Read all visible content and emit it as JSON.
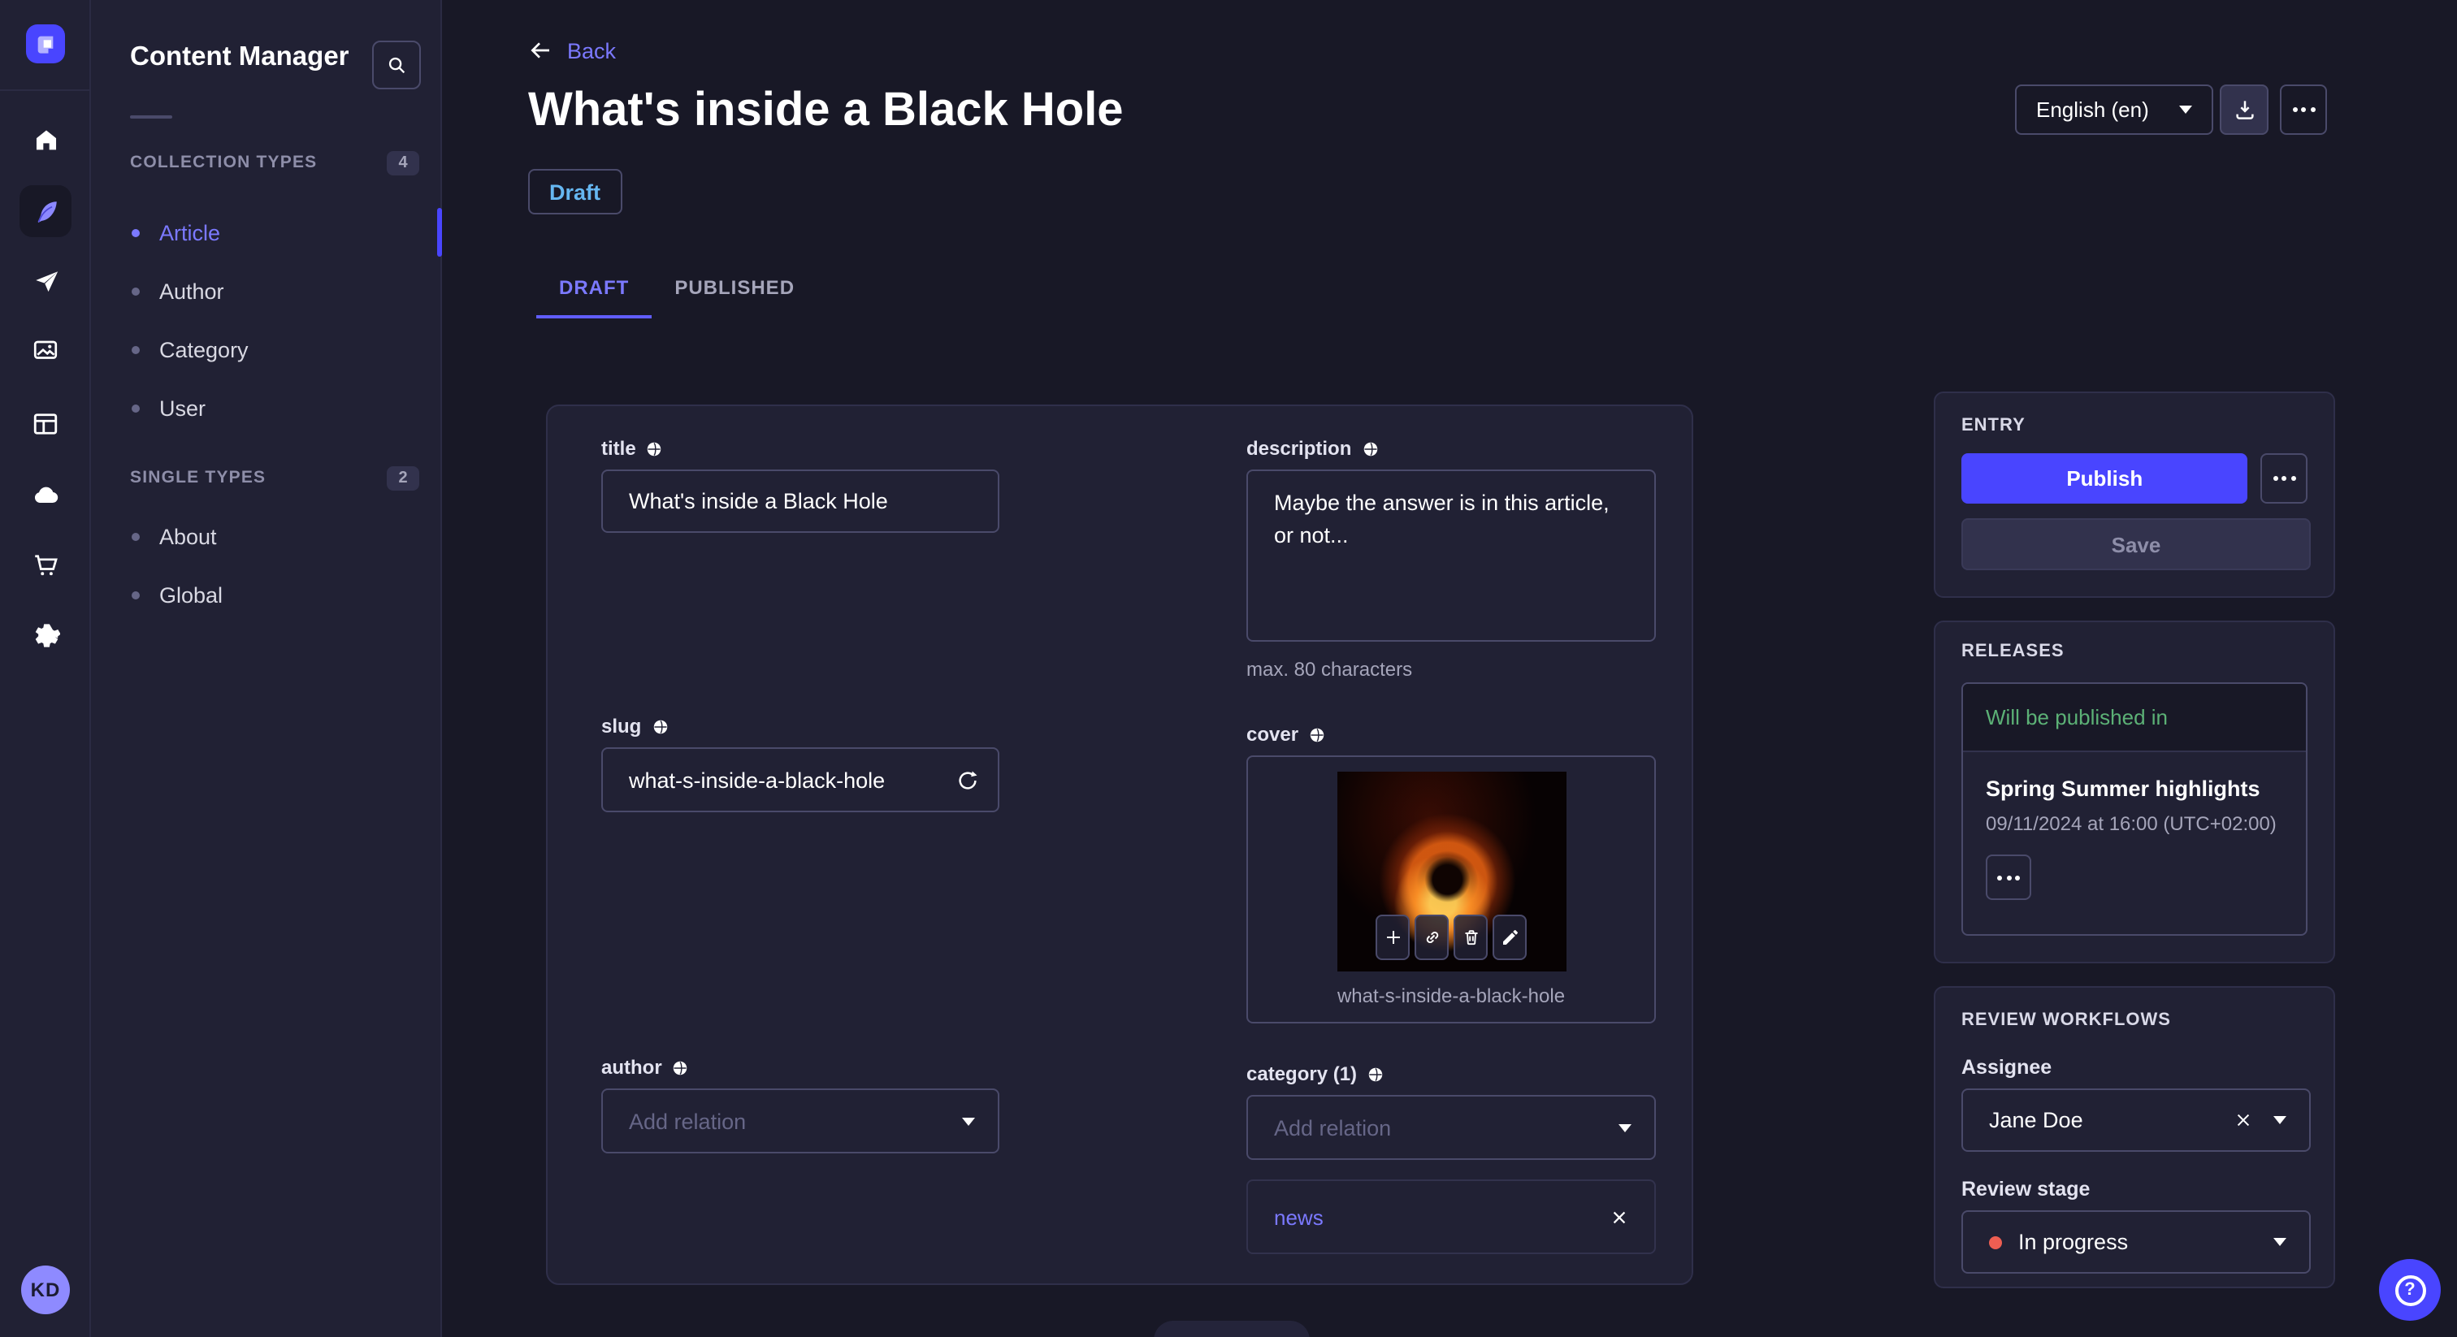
{
  "subnav": {
    "title": "Content Manager",
    "sections": [
      {
        "label": "COLLECTION TYPES",
        "badge": "4",
        "items": [
          {
            "label": "Article"
          },
          {
            "label": "Author"
          },
          {
            "label": "Category"
          },
          {
            "label": "User"
          }
        ]
      },
      {
        "label": "SINGLE TYPES",
        "badge": "2",
        "items": [
          {
            "label": "About"
          },
          {
            "label": "Global"
          }
        ]
      }
    ]
  },
  "header": {
    "back_label": "Back",
    "title": "What's inside a Black Hole",
    "status_badge": "Draft",
    "locale": "English (en)",
    "tabs": {
      "draft": "DRAFT",
      "published": "PUBLISHED"
    }
  },
  "form": {
    "title": {
      "label": "title",
      "value": "What's inside a Black Hole"
    },
    "description": {
      "label": "description",
      "value": "Maybe the answer is in this article, or not...",
      "hint": "max. 80 characters"
    },
    "slug": {
      "label": "slug",
      "value": "what-s-inside-a-black-hole"
    },
    "cover": {
      "label": "cover",
      "caption": "what-s-inside-a-black-hole"
    },
    "author": {
      "label": "author",
      "placeholder": "Add relation"
    },
    "category": {
      "label": "category (1)",
      "placeholder": "Add relation",
      "relation": "news"
    }
  },
  "entry": {
    "heading": "ENTRY",
    "publish_label": "Publish",
    "save_label": "Save"
  },
  "releases": {
    "heading": "RELEASES",
    "banner": "Will be published in",
    "name": "Spring Summer highlights",
    "date": "09/11/2024 at 16:00 (UTC+02:00)"
  },
  "review": {
    "heading": "REVIEW WORKFLOWS",
    "assignee_label": "Assignee",
    "assignee_value": "Jane Doe",
    "stage_label": "Review stage",
    "stage_value": "In progress"
  },
  "user": {
    "initials": "KD"
  },
  "help": {
    "glyph": "?"
  },
  "colors": {
    "primary": "#4945ff",
    "primary_light": "#7b79ff",
    "success": "#5cb176",
    "danger": "#ee5e52",
    "draft_badge": "#66b7f1"
  },
  "icons": {
    "rail": [
      "home-icon",
      "content-manager-icon",
      "releases-icon",
      "media-library-icon",
      "content-type-builder-icon",
      "cloud-icon",
      "marketplace-icon",
      "settings-icon"
    ],
    "search": "magnifier-icon",
    "download": "download-icon",
    "more": "ellipsis-icon",
    "back": "arrow-left-icon",
    "localized_field": "globe-icon",
    "regenerate": "refresh-icon",
    "cover_actions": [
      "plus-icon",
      "link-icon",
      "trash-icon",
      "pencil-icon"
    ],
    "remove": "x-icon",
    "dropdown": "chevron-down-icon",
    "help": "question-mark-icon"
  }
}
